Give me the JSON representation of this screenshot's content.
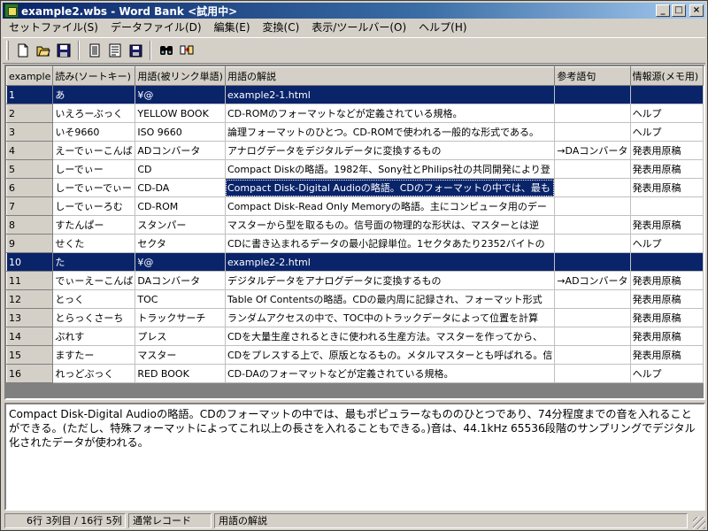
{
  "window": {
    "title": "example2.wbs - Word Bank <試用中>",
    "buttons": {
      "minimize": "_",
      "maximize": "□",
      "close": "×"
    }
  },
  "menu": [
    "セットファイル(S)",
    "データファイル(D)",
    "編集(E)",
    "変換(C)",
    "表示/ツールバー(O)",
    "ヘルプ(H)"
  ],
  "toolbar": {
    "icons": [
      "new-file-icon",
      "open-folder-icon",
      "save-icon",
      "document-icon",
      "list-document-icon",
      "save-as-icon",
      "find-icon",
      "transfer-icon"
    ]
  },
  "grid": {
    "columns": [
      "example",
      "読み(ソートキー)",
      "用語(被リンク単語)",
      "用語の解説",
      "参考語句",
      "情報源(メモ用)"
    ],
    "rows": [
      {
        "num": "1",
        "cells": [
          "あ",
          "¥@",
          "example2-1.html",
          "",
          ""
        ],
        "selected": true
      },
      {
        "num": "2",
        "cells": [
          "いえろーぶっく",
          "YELLOW BOOK",
          "CD-ROMのフォーマットなどが定義されている規格。",
          "",
          "ヘルプ"
        ]
      },
      {
        "num": "3",
        "cells": [
          "いそ9660",
          "ISO 9660",
          "論理フォーマットのひとつ。CD-ROMで使われる一般的な形式である。",
          "",
          "ヘルプ"
        ]
      },
      {
        "num": "4",
        "cells": [
          "えーでぃーこんば",
          "ADコンバータ",
          "アナログデータをデジタルデータに変換するもの",
          "→DAコンバータ",
          "発表用原稿"
        ]
      },
      {
        "num": "5",
        "cells": [
          "しーでぃー",
          "CD",
          "Compact Diskの略語。1982年、Sony社とPhilips社の共同開発により登",
          "",
          "発表用原稿"
        ]
      },
      {
        "num": "6",
        "cells": [
          "しーでぃーでぃー",
          "CD-DA",
          "Compact Disk-Digital Audioの略語。CDのフォーマットの中では、最も",
          "",
          "発表用原稿"
        ],
        "active_cell": 2
      },
      {
        "num": "7",
        "cells": [
          "しーでぃーろむ",
          "CD-ROM",
          "Compact Disk-Read Only Memoryの略語。主にコンピュータ用のデー",
          "",
          ""
        ]
      },
      {
        "num": "8",
        "cells": [
          "すたんぱー",
          "スタンパー",
          "マスターから型を取るもの。信号面の物理的な形状は、マスターとは逆",
          "",
          "発表用原稿"
        ]
      },
      {
        "num": "9",
        "cells": [
          "せくた",
          "セクタ",
          "CDに書き込まれるデータの最小記録単位。1セクタあたり2352バイトの",
          "",
          "ヘルプ"
        ]
      },
      {
        "num": "10",
        "cells": [
          "た",
          "¥@",
          "example2-2.html",
          "",
          ""
        ],
        "selected": true
      },
      {
        "num": "11",
        "cells": [
          "でぃーえーこんば",
          "DAコンバータ",
          "デジタルデータをアナログデータに変換するもの",
          "→ADコンバータ",
          "発表用原稿"
        ]
      },
      {
        "num": "12",
        "cells": [
          "とっく",
          "TOC",
          "Table Of Contentsの略語。CDの最内周に記録され、フォーマット形式",
          "",
          "発表用原稿"
        ]
      },
      {
        "num": "13",
        "cells": [
          "とらっくさーち",
          "トラックサーチ",
          "ランダムアクセスの中で、TOC中のトラックデータによって位置を計算",
          "",
          "発表用原稿"
        ]
      },
      {
        "num": "14",
        "cells": [
          "ぷれす",
          "プレス",
          "CDを大量生産されるときに使われる生産方法。マスターを作ってから、",
          "",
          "発表用原稿"
        ]
      },
      {
        "num": "15",
        "cells": [
          "ますたー",
          "マスター",
          "CDをプレスする上で、原版となるもの。メタルマスターとも呼ばれる。信",
          "",
          "発表用原稿"
        ]
      },
      {
        "num": "16",
        "cells": [
          "れっどぶっく",
          "RED BOOK",
          "CD-DAのフォーマットなどが定義されている規格。",
          "",
          "ヘルプ"
        ]
      }
    ]
  },
  "detail": {
    "text": "Compact Disk-Digital Audioの略語。CDのフォーマットの中では、最もポピュラーなもののひとつであり、74分程度までの音を入れること\nができる。(ただし、特殊フォーマットによってこれ以上の長さを入れることもできる。)音は、44.1kHz 65536段階のサンプリングでデジタル\n化されたデータが使われる。"
  },
  "status": {
    "position": "6行 3列目 / 16行 5列",
    "mode": "通常レコード",
    "field": "用語の解説"
  }
}
